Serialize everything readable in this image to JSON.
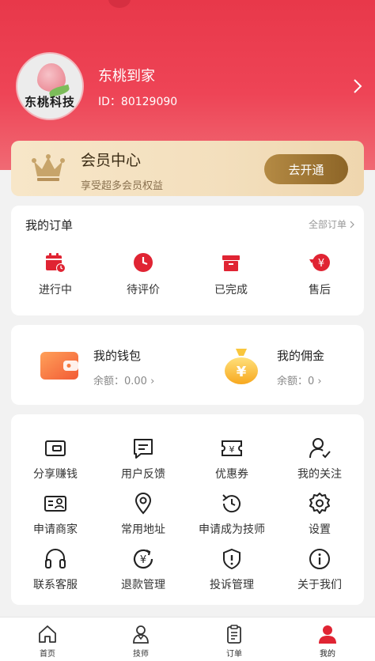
{
  "colors": {
    "brand": "#e8384a",
    "gold": "#a07a36",
    "text": "#222222",
    "muted": "#888888"
  },
  "profile": {
    "avatar_text": "东桃科技",
    "name": "东桃到家",
    "id_label": "ID：80129090"
  },
  "member": {
    "title": "会员中心",
    "subtitle": "享受超多会员权益",
    "button": "去开通"
  },
  "orders": {
    "title": "我的订单",
    "all_label": "全部订单",
    "items": [
      {
        "label": "进行中",
        "icon": "calendar-clock-icon"
      },
      {
        "label": "待评价",
        "icon": "clock-icon"
      },
      {
        "label": "已完成",
        "icon": "box-icon"
      },
      {
        "label": "售后",
        "icon": "yen-return-icon"
      }
    ]
  },
  "wallet": {
    "wallet_title": "我的钱包",
    "wallet_balance": "余额：0.00",
    "commission_title": "我的佣金",
    "commission_balance": "余额：0"
  },
  "tools": [
    {
      "label": "分享赚钱",
      "icon": "wallet-card-icon"
    },
    {
      "label": "用户反馈",
      "icon": "feedback-icon"
    },
    {
      "label": "优惠券",
      "icon": "coupon-icon"
    },
    {
      "label": "我的关注",
      "icon": "user-check-icon"
    },
    {
      "label": "申请商家",
      "icon": "id-card-icon"
    },
    {
      "label": "常用地址",
      "icon": "location-icon"
    },
    {
      "label": "申请成为技师",
      "icon": "history-icon"
    },
    {
      "label": "设置",
      "icon": "settings-icon"
    },
    {
      "label": "联系客服",
      "icon": "headset-icon"
    },
    {
      "label": "退款管理",
      "icon": "refund-icon"
    },
    {
      "label": "投诉管理",
      "icon": "shield-alert-icon"
    },
    {
      "label": "关于我们",
      "icon": "info-icon"
    }
  ],
  "tabbar": [
    {
      "label": "首页",
      "icon": "home-icon"
    },
    {
      "label": "技师",
      "icon": "technician-icon"
    },
    {
      "label": "订单",
      "icon": "clipboard-icon"
    },
    {
      "label": "我的",
      "icon": "profile-icon",
      "active": true
    }
  ]
}
